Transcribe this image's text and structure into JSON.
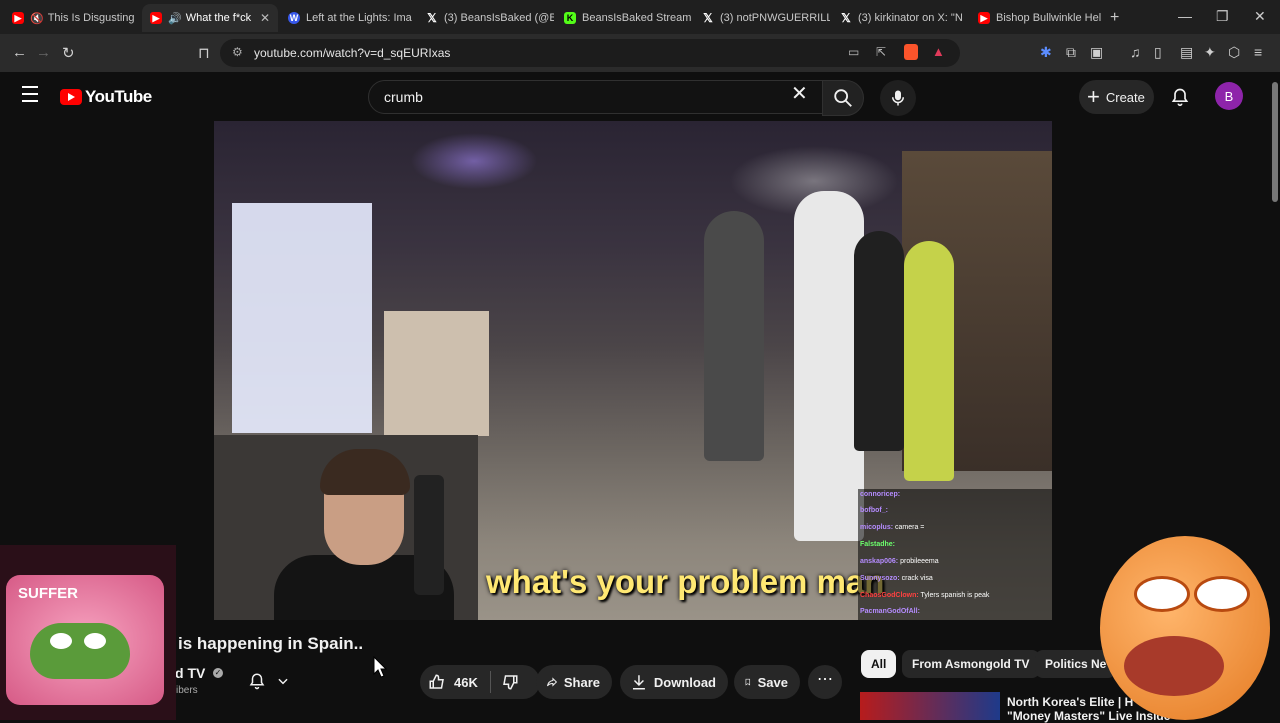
{
  "browser": {
    "tabs": [
      {
        "title": "This Is Disgusting",
        "favicon": "youtube-muted-icon"
      },
      {
        "title": "What the f*ck",
        "favicon": "youtube-audio-icon",
        "active": true
      },
      {
        "title": "Left at the Lights: Ima",
        "favicon": "wordpress-icon"
      },
      {
        "title": "(3) BeansIsBaked (@B",
        "favicon": "x-icon"
      },
      {
        "title": "BeansIsBaked Stream",
        "favicon": "kick-icon"
      },
      {
        "title": "(3) notPNWGUERRILL",
        "favicon": "x-icon"
      },
      {
        "title": "(3) kirkinator on X: \"N",
        "favicon": "x-icon"
      },
      {
        "title": "Bishop Bullwinkle Hel",
        "favicon": "youtube-icon"
      }
    ],
    "new_tab": "+",
    "url": "youtube.com/watch?v=d_sqEURIxas"
  },
  "youtube": {
    "logo_text": "YouTube",
    "search": {
      "value": "crumb",
      "placeholder": "Search"
    },
    "create_label": "Create",
    "avatar_letter": "B"
  },
  "video": {
    "subtitle": "what's your problem man",
    "chat": [
      {
        "user": "connoricep:",
        "msg": "",
        "color": "#b58cff"
      },
      {
        "user": "bofbof_:",
        "msg": "",
        "color": "#b58cff"
      },
      {
        "user": "micoplus:",
        "msg": "camera =",
        "color": "#b58cff"
      },
      {
        "user": "Falstadhe:",
        "msg": "",
        "color": "#6cff6c"
      },
      {
        "user": "anskap006:",
        "msg": "probileeema",
        "color": "#b58cff"
      },
      {
        "user": "Sunnysozo:",
        "msg": "crack visa",
        "color": "#b58cff"
      },
      {
        "user": "ChaosGodClown:",
        "msg": "Tylers spanish is peak",
        "color": "#ff4040"
      },
      {
        "user": "PacmanGodOfAll:",
        "msg": "",
        "color": "#b58cff"
      }
    ]
  },
  "meta": {
    "title": "is happening in Spain..",
    "channel": "d TV",
    "subs": "ibers",
    "likes": "46K",
    "share_label": "Share",
    "download_label": "Download",
    "save_label": "Save"
  },
  "chips": [
    "All",
    "From Asmongold TV",
    "Politics Ne"
  ],
  "related": {
    "title_line1": "North Korea's Elite | H",
    "title_line2": "\"Money Masters\" Live Inside"
  },
  "overlay": {
    "suffer_text": "SUFFER"
  }
}
